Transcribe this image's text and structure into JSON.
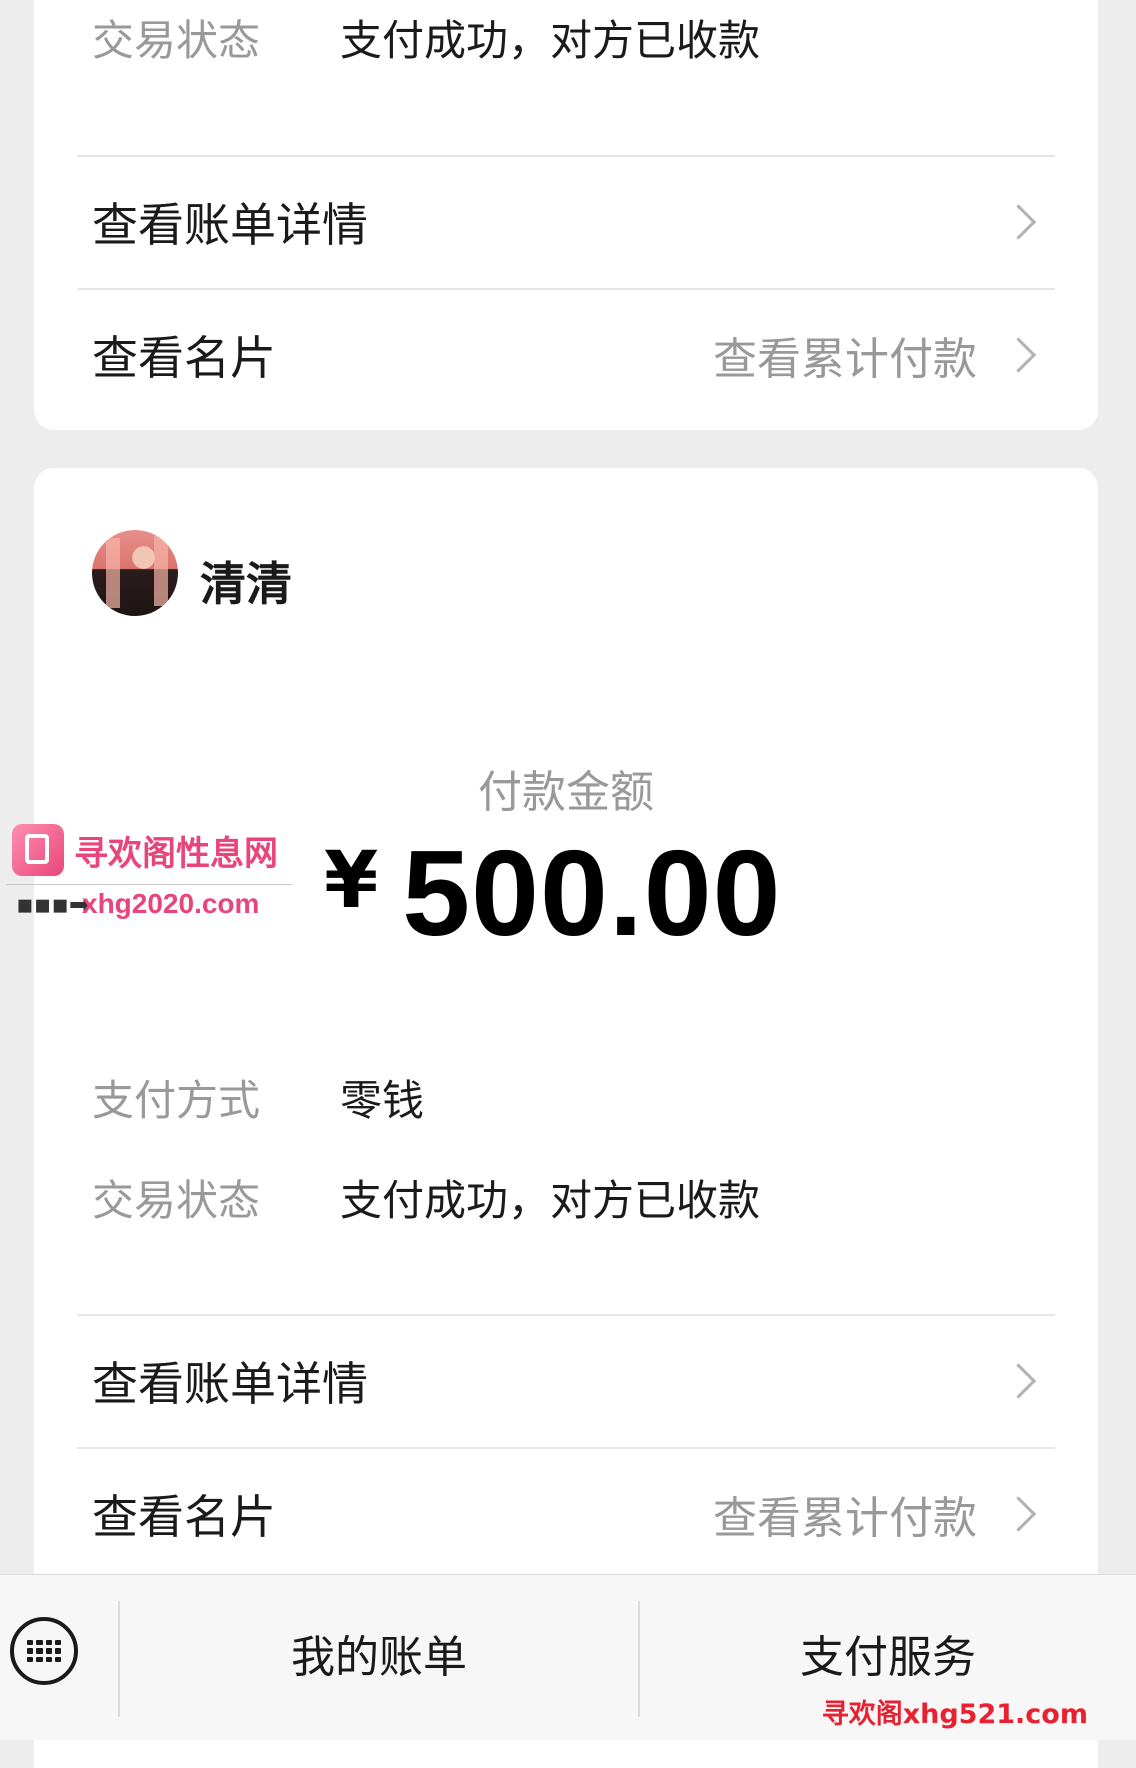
{
  "top_card": {
    "status_label": "交易状态",
    "status_value": "支付成功，对方已收款",
    "bill_detail_label": "查看账单详情",
    "card_label": "查看名片",
    "cumulative_label": "查看累计付款"
  },
  "main_card": {
    "payee_name": "清清",
    "amount_label": "付款金额",
    "currency": "¥",
    "amount": "500.00",
    "method_label": "支付方式",
    "method_value": "零钱",
    "status_label": "交易状态",
    "status_value": "支付成功，对方已收款",
    "bill_detail_label": "查看账单详情",
    "card_label": "查看名片",
    "cumulative_label": "查看累计付款"
  },
  "bottom_bar": {
    "my_bills": "我的账单",
    "pay_services": "支付服务"
  },
  "watermarks": {
    "site_name": "寻欢阁性息网",
    "site_url": "xhg2020.com",
    "arrow": "▪▪▪➡",
    "footer": "寻欢阁xhg521.com"
  },
  "colors": {
    "background": "#ededed",
    "card": "#ffffff",
    "label_gray": "#999999",
    "text": "#1a1a1a",
    "watermark_pink": "#e8457a",
    "watermark_red": "#e8202f"
  },
  "icons": {
    "chevron": "chevron-right-icon",
    "keyboard": "keyboard-icon",
    "logo": "watermark-logo-icon"
  }
}
